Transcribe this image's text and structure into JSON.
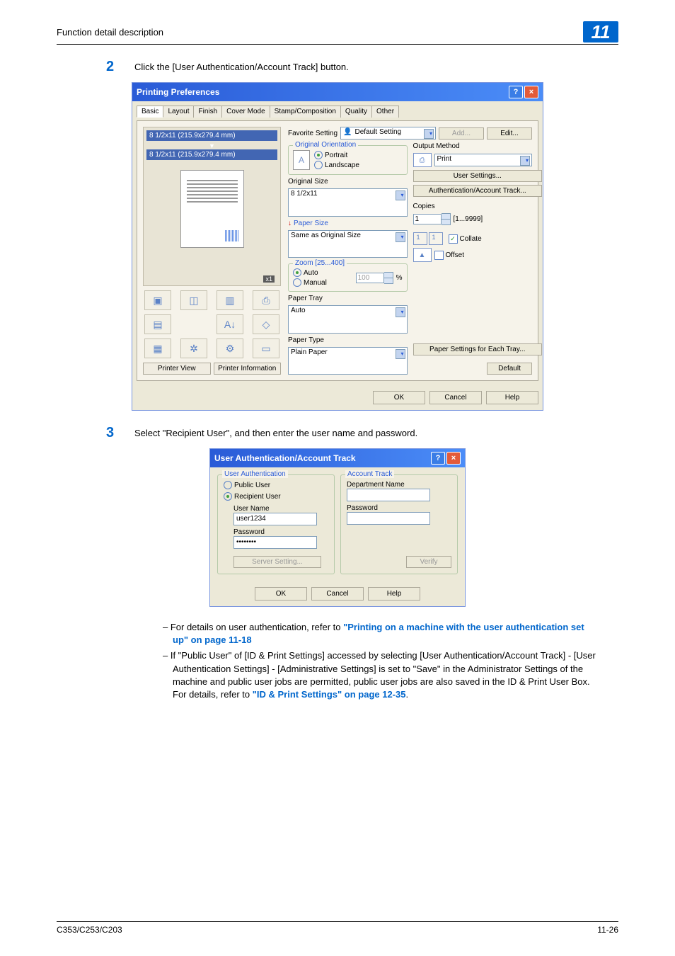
{
  "header": {
    "section_title": "Function detail description",
    "chapter_number": "11"
  },
  "steps": {
    "s2": {
      "num": "2",
      "text": "Click the [User Authentication/Account Track] button."
    },
    "s3": {
      "num": "3",
      "text": "Select \"Recipient User\", and then enter the user name and password."
    }
  },
  "prefs_dialog": {
    "title": "Printing Preferences",
    "tabs": [
      "Basic",
      "Layout",
      "Finish",
      "Cover Mode",
      "Stamp/Composition",
      "Quality",
      "Other"
    ],
    "preview_top": "8 1/2x11 (215.9x279.4 mm)",
    "preview_bottom": "8 1/2x11 (215.9x279.4 mm)",
    "x1_label": "x1",
    "printer_view_btn": "Printer View",
    "printer_info_btn": "Printer Information",
    "favorite_label": "Favorite Setting",
    "favorite_value": "Default Setting",
    "add_btn": "Add...",
    "edit_btn": "Edit...",
    "orientation": {
      "legend": "Original Orientation",
      "portrait": "Portrait",
      "landscape": "Landscape"
    },
    "original_size_label": "Original Size",
    "original_size_value": "8 1/2x11",
    "paper_size_label": "Paper Size",
    "paper_size_value": "Same as Original Size",
    "zoom": {
      "legend": "Zoom [25...400]",
      "auto": "Auto",
      "manual": "Manual",
      "value": "100",
      "percent": "%"
    },
    "paper_tray_label": "Paper Tray",
    "paper_tray_value": "Auto",
    "paper_type_label": "Paper Type",
    "paper_type_value": "Plain Paper",
    "output_method_label": "Output Method",
    "output_method_value": "Print",
    "user_settings_btn": "User Settings...",
    "auth_track_btn": "Authentication/Account Track...",
    "copies_label": "Copies",
    "copies_value": "1",
    "copies_range": "[1...9999]",
    "collate_label": "Collate",
    "offset_label": "Offset",
    "paper_settings_btn": "Paper Settings for Each Tray...",
    "default_btn": "Default",
    "ok": "OK",
    "cancel": "Cancel",
    "help": "Help"
  },
  "auth_dialog": {
    "title": "User Authentication/Account Track",
    "user_auth_legend": "User Authentication",
    "public_user": "Public User",
    "recipient_user": "Recipient User",
    "user_name_label": "User Name",
    "user_name_value": "user1234",
    "password_label": "Password",
    "password_value": "••••••••",
    "server_setting_btn": "Server Setting...",
    "account_track_legend": "Account Track",
    "dept_name_label": "Department Name",
    "acct_password_label": "Password",
    "verify_btn": "Verify",
    "ok": "OK",
    "cancel": "Cancel",
    "help": "Help"
  },
  "notes": {
    "n1a": "For details on user authentication, refer to ",
    "n1_link": "\"Printing on a machine with the user authentication set up\" on page 11-18",
    "n2a": "If \"Public User\" of [ID & Print Settings] accessed by selecting [User Authentication/Account Track] - [User Authentication Settings] - [Administrative Settings] is set to \"Save\" in the Administrator Settings of the machine and public user jobs are permitted, public user jobs are also saved in the ID & Print User Box. For details, refer to ",
    "n2_link": "\"ID & Print Settings\" on page 12-35",
    "period": "."
  },
  "footer": {
    "model": "C353/C253/C203",
    "page": "11-26"
  }
}
